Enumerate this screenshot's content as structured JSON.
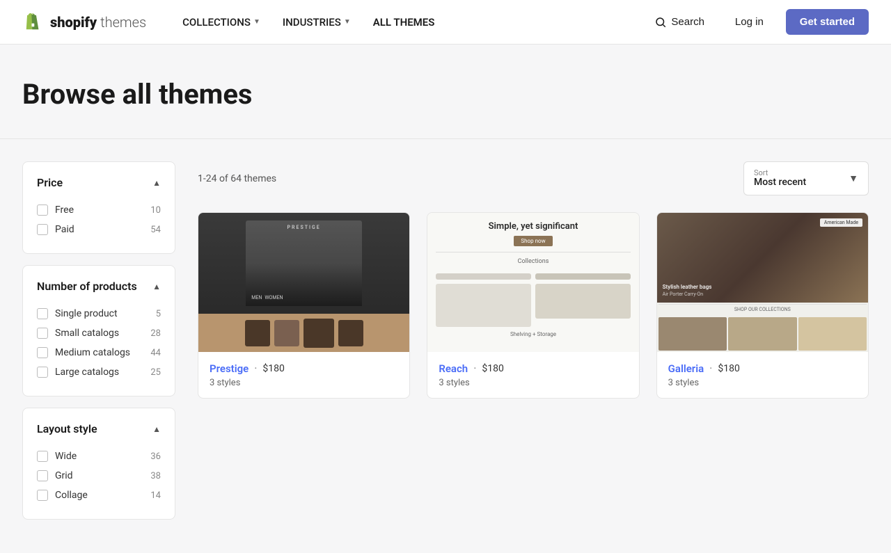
{
  "header": {
    "logo_brand": "shopify",
    "logo_suffix": "themes",
    "nav_items": [
      {
        "label": "COLLECTIONS",
        "has_dropdown": true
      },
      {
        "label": "INDUSTRIES",
        "has_dropdown": true
      },
      {
        "label": "ALL THEMES",
        "has_dropdown": false
      }
    ],
    "search_label": "Search",
    "login_label": "Log in",
    "cta_label": "Get started"
  },
  "hero": {
    "title": "Browse all themes"
  },
  "filters": {
    "price": {
      "title": "Price",
      "items": [
        {
          "label": "Free",
          "count": 10
        },
        {
          "label": "Paid",
          "count": 54
        }
      ]
    },
    "number_of_products": {
      "title": "Number of products",
      "items": [
        {
          "label": "Single product",
          "count": 5
        },
        {
          "label": "Small catalogs",
          "count": 28
        },
        {
          "label": "Medium catalogs",
          "count": 44
        },
        {
          "label": "Large catalogs",
          "count": 25
        }
      ]
    },
    "layout_style": {
      "title": "Layout style",
      "items": [
        {
          "label": "Wide",
          "count": 36
        },
        {
          "label": "Grid",
          "count": 38
        },
        {
          "label": "Collage",
          "count": 14
        }
      ]
    }
  },
  "content": {
    "results_text": "1-24 of 64 themes",
    "sort": {
      "label": "Sort",
      "value": "Most recent"
    },
    "themes": [
      {
        "name": "Prestige",
        "price": "$180",
        "styles": "3 styles",
        "image_type": "prestige"
      },
      {
        "name": "Reach",
        "price": "$180",
        "styles": "3 styles",
        "image_type": "reach"
      },
      {
        "name": "Galleria",
        "price": "$180",
        "styles": "3 styles",
        "image_type": "galleria"
      }
    ]
  }
}
